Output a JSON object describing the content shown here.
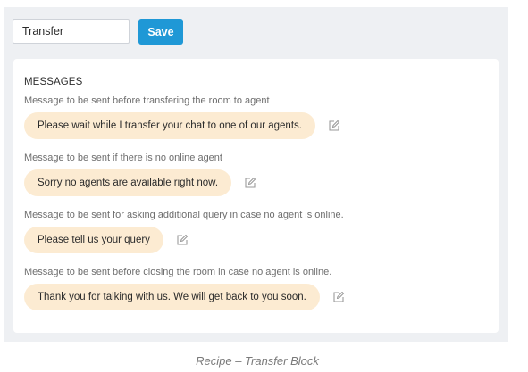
{
  "toolbar": {
    "name_value": "Transfer",
    "save_label": "Save"
  },
  "messages_panel": {
    "title": "MESSAGES",
    "items": [
      {
        "label": "Message to be sent before transfering the room to agent",
        "message": "Please wait while I transfer your chat to one of our agents."
      },
      {
        "label": "Message to be sent if there is no online agent",
        "message": "Sorry no agents are available right now."
      },
      {
        "label": "Message to be sent for asking additional query in case no agent is online.",
        "message": "Please tell us your query"
      },
      {
        "label": "Message to be sent before closing the room in case no agent is online.",
        "message": "Thank you for talking with us. We will get back to you soon."
      }
    ],
    "edit_icon": "edit-icon"
  },
  "caption": "Recipe – Transfer Block",
  "colors": {
    "accent": "#1f98d6",
    "bubble": "#fcebd2",
    "background": "#eef0f3"
  }
}
